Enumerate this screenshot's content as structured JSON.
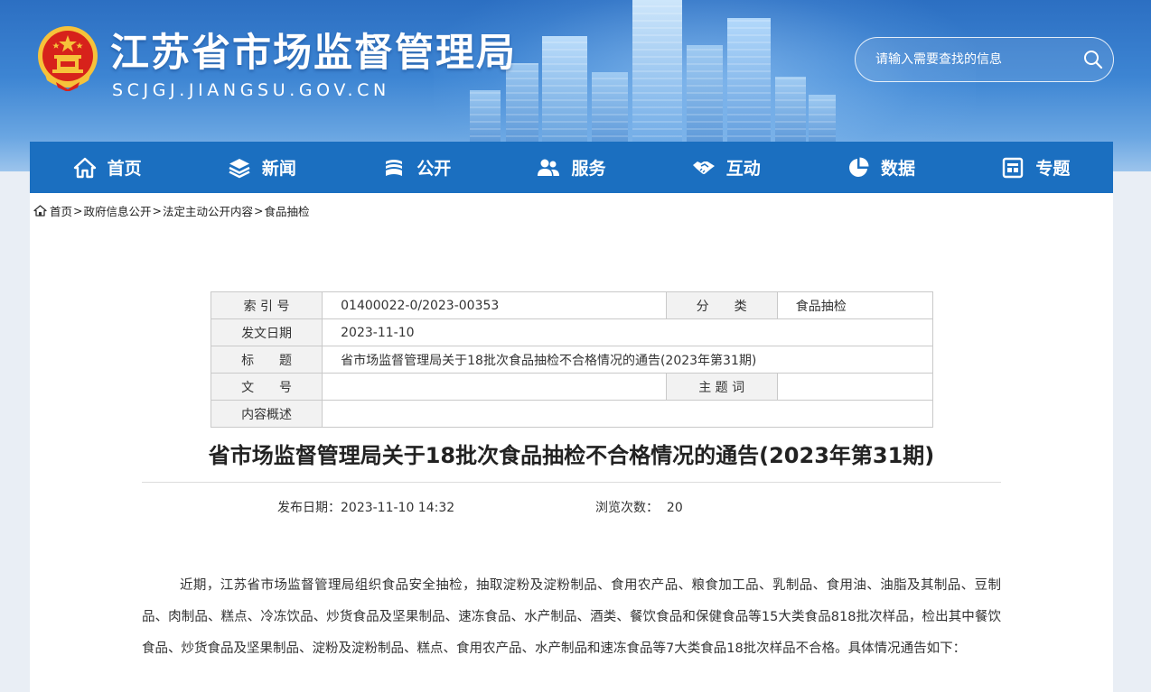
{
  "header": {
    "title": "江苏省市场监督管理局",
    "domain": "SCJGJ.JIANGSU.GOV.CN",
    "search_placeholder": "请输入需要查找的信息"
  },
  "nav": {
    "items": [
      {
        "label": "首页",
        "icon": "home-icon"
      },
      {
        "label": "新闻",
        "icon": "layers-icon"
      },
      {
        "label": "公开",
        "icon": "stack-icon"
      },
      {
        "label": "服务",
        "icon": "people-icon"
      },
      {
        "label": "互动",
        "icon": "handshake-icon"
      },
      {
        "label": "数据",
        "icon": "pie-chart-icon"
      },
      {
        "label": "专题",
        "icon": "board-icon"
      }
    ]
  },
  "breadcrumb": {
    "items": [
      "首页",
      "政府信息公开",
      "法定主动公开内容",
      "食品抽检"
    ],
    "separator": ">"
  },
  "meta": {
    "index_label": "索 引 号",
    "index_value": "01400022-0/2023-00353",
    "category_label": "分　　类",
    "category_value": "食品抽检",
    "date_label": "发文日期",
    "date_value": "2023-11-10",
    "title_label": "标　　题",
    "title_value": "省市场监督管理局关于18批次食品抽检不合格情况的通告(2023年第31期)",
    "docno_label": "文　　号",
    "docno_value": "",
    "keywords_label": "主 题 词",
    "keywords_value": "",
    "summary_label": "内容概述",
    "summary_value": ""
  },
  "article": {
    "title": "省市场监督管理局关于18批次食品抽检不合格情况的通告(2023年第31期)",
    "publish_label": "发布日期：",
    "publish_value": "2023-11-10 14:32",
    "views_label": "浏览次数：",
    "views_value": "20",
    "paragraph": "近期，江苏省市场监督管理局组织食品安全抽检，抽取淀粉及淀粉制品、食用农产品、粮食加工品、乳制品、食用油、油脂及其制品、豆制品、肉制品、糕点、冷冻饮品、炒货食品及坚果制品、速冻食品、水产制品、酒类、餐饮食品和保健食品等15大类食品818批次样品，检出其中餐饮食品、炒货食品及坚果制品、淀粉及淀粉制品、糕点、食用农产品、水产制品和速冻食品等7大类食品18批次样品不合格。具体情况通告如下："
  },
  "colors": {
    "nav_bg": "#1b6fc0",
    "banner_top": "#2c6fc2",
    "emblem_red": "#d7221b",
    "emblem_gold": "#f6c23a"
  }
}
